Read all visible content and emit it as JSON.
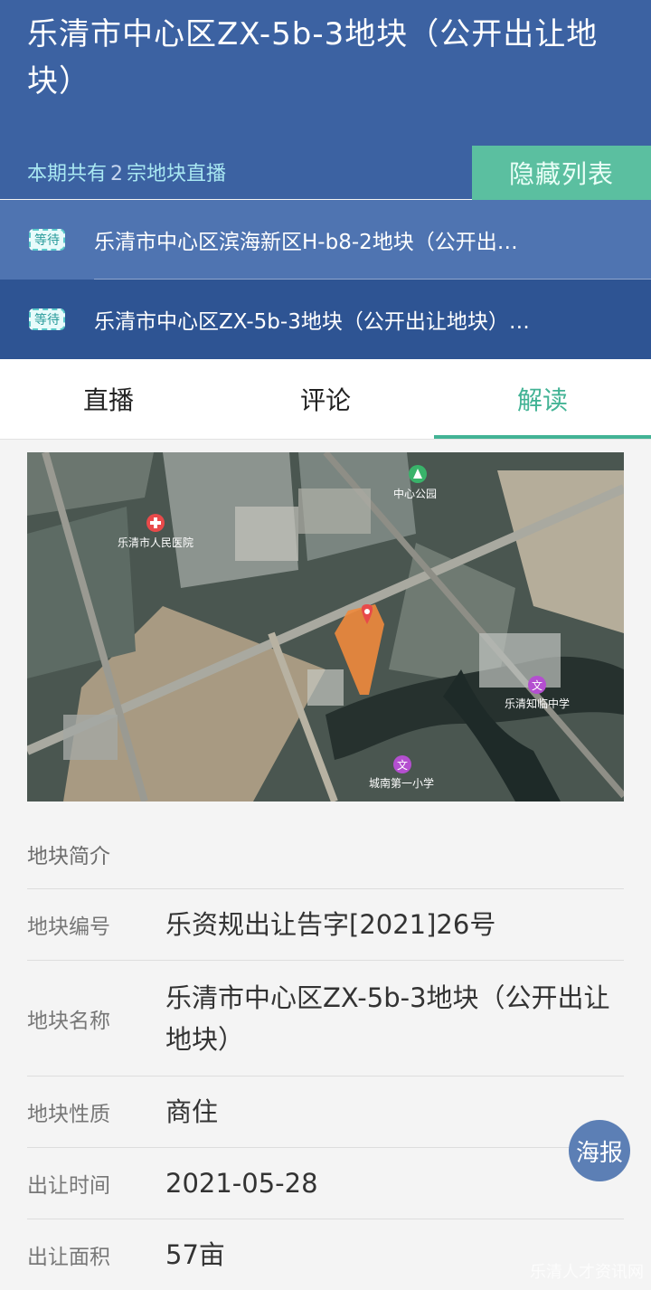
{
  "header": {
    "title": "乐清市中心区ZX-5b-3地块（公开出让地块）",
    "count_prefix": "本期共有",
    "count_value": "2",
    "count_suffix": "宗地块直播",
    "hide_button": "隐藏列表"
  },
  "plots": [
    {
      "badge": "等待",
      "label": "乐清市中心区滨海新区H-b8-2地块（公开出…"
    },
    {
      "badge": "等待",
      "label": "乐清市中心区ZX-5b-3地块（公开出让地块）…"
    }
  ],
  "tabs": [
    {
      "label": "直播"
    },
    {
      "label": "评论"
    },
    {
      "label": "解读",
      "active": true
    }
  ],
  "map": {
    "labels": {
      "park": "中心公园",
      "hospital": "乐清市人民医院",
      "middle_school": "乐清知临中学",
      "primary_school": "城南第一小学"
    },
    "icons": [
      "park-icon",
      "hospital-icon",
      "school-icon",
      "location-pin-icon"
    ],
    "colors": {
      "plot_highlight": "#f08a3c",
      "pin": "#e84a4a"
    }
  },
  "info": {
    "section_title": "地块简介",
    "rows": [
      {
        "label": "地块编号",
        "value": "乐资规出让告字[2021]26号"
      },
      {
        "label": "地块名称",
        "value": "乐清市中心区ZX-5b-3地块（公开出让地块）"
      },
      {
        "label": "地块性质",
        "value": "商住"
      },
      {
        "label": "出让时间",
        "value": "2021-05-28"
      },
      {
        "label": "出让面积",
        "value": "57亩"
      }
    ]
  },
  "poster_button": "海报",
  "watermark": "乐清人才资讯网"
}
